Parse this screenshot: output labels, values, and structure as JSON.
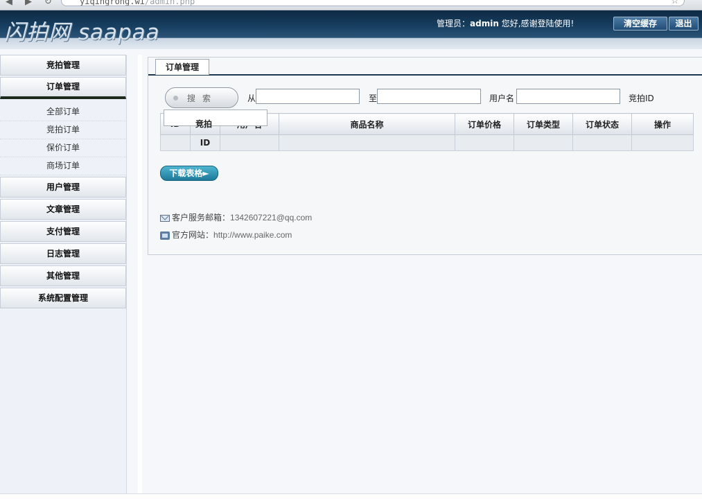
{
  "browser": {
    "url_prefix": "yiqingrong.wi",
    "url_rest": "/admin.php"
  },
  "header": {
    "logo_text": "闪拍网 saapaa",
    "admin_label": "管理员：",
    "admin_name": "admin",
    "admin_suffix": " 您好,感谢登陆使用!",
    "clear_cache_label": "清空缓存",
    "logout_label": "退出"
  },
  "sidebar": {
    "menus": [
      {
        "label": "竞拍管理"
      },
      {
        "label": "订单管理"
      },
      {
        "label": "用户管理"
      },
      {
        "label": "文章管理"
      },
      {
        "label": "支付管理"
      },
      {
        "label": "日志管理"
      },
      {
        "label": "其他管理"
      },
      {
        "label": "系统配置管理"
      }
    ],
    "order_submenu": [
      "全部订单",
      "竞拍订单",
      "保价订单",
      "商场订单"
    ]
  },
  "main": {
    "tab_label": "订单管理",
    "search_button": "搜索",
    "from_label": "从",
    "to_label": "至",
    "username_label": "用户名",
    "auction_id_label": "竞拍ID",
    "from_value": "",
    "to_value": "",
    "username_value": "",
    "dropdown_option": "竞拍",
    "table": {
      "headers": [
        "ID",
        "",
        "用户名",
        "商品名称",
        "订单价格",
        "订单类型",
        "订单状态",
        "操作"
      ],
      "row": [
        "",
        "ID",
        "",
        "",
        "",
        "",
        "",
        ""
      ]
    },
    "download_button": "下载表格►",
    "footer": {
      "email_label": "客户服务邮箱：",
      "email_value": "1342607221@qq.com",
      "site_label": "官方网站：",
      "site_value": "http://www.paike.com"
    }
  },
  "colors": {
    "header_dark": "#0e2a44",
    "sidebar_bg": "#eef2f8",
    "download_btn": "#1e7a99"
  }
}
